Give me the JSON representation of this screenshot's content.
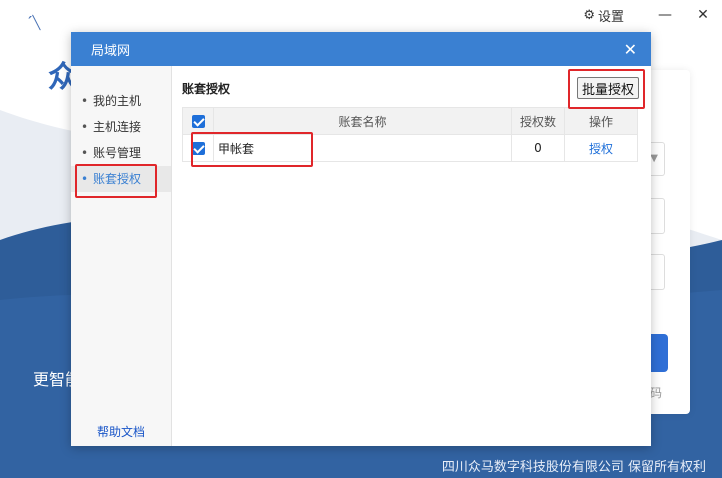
{
  "background": {
    "settings_label": "设置",
    "big_text": "众",
    "slogan": "更智能",
    "code_text": "码",
    "footer": "四川众马数字科技股份有限公司  保留所有权利",
    "colors": {
      "brand_blue": "#2f66b8",
      "wave_blue": "#2e5d99"
    }
  },
  "dialog": {
    "title": "局域网",
    "close_symbol": "✕",
    "sidebar": {
      "items": [
        {
          "label": "我的主机"
        },
        {
          "label": "主机连接"
        },
        {
          "label": "账号管理"
        },
        {
          "label": "账套授权",
          "active": true
        }
      ],
      "help_link": "帮助文档"
    },
    "main": {
      "section_title": "账套授权",
      "batch_button": "批量授权",
      "table": {
        "headers": [
          "",
          "账套名称",
          "授权数",
          "操作"
        ],
        "rows": [
          {
            "checked": true,
            "name": "甲帐套",
            "count": "0",
            "action": "授权"
          }
        ]
      }
    },
    "colors": {
      "header_bg": "#3a80d2",
      "highlight": "#e0262a",
      "link": "#1e6fd9"
    }
  }
}
